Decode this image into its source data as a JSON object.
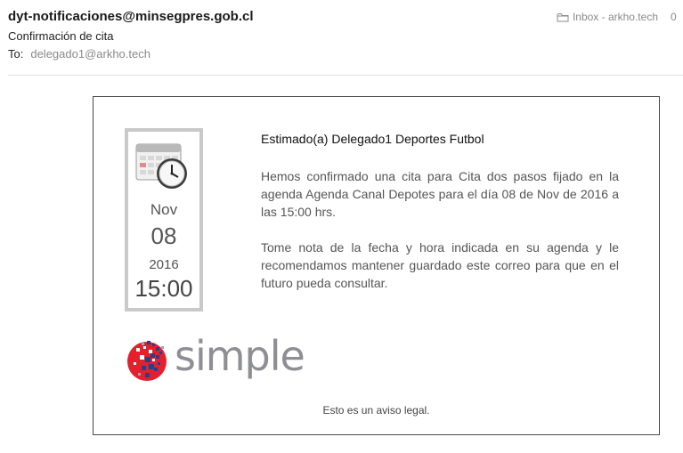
{
  "header": {
    "sender": "dyt-notificaciones@minsegpres.gob.cl",
    "mailbox": "Inbox - arkho.tech",
    "count": "0",
    "subject": "Confirmación de cita",
    "to_label": "To:",
    "to_value": "delegado1@arkho.tech"
  },
  "email": {
    "calendar": {
      "month": "Nov",
      "day": "08",
      "year": "2016",
      "time": "15:00"
    },
    "greeting": "Estimado(a) Delegado1 Deportes Futbol",
    "paragraph1": "Hemos confirmado una cita para Cita dos pasos fijado en la agenda Agenda Canal Depotes para el día 08 de Nov de 2016 a las 15:00 hrs.",
    "paragraph2": "Tome nota de la fecha y hora indicada en su agenda y le recomendamos mantener guardado este correo para que en el futuro pueda consultar.",
    "logo_text": "simple",
    "legal": "Esto es un aviso legal."
  },
  "colors": {
    "logo_red": "#e3202b",
    "logo_blue": "#2a3d8f",
    "logo_gray": "#8e8e95",
    "calendar_border": "#c9c9c9"
  },
  "icons": {
    "mailbox": "folder-icon",
    "calendar": "calendar-clock-icon"
  }
}
